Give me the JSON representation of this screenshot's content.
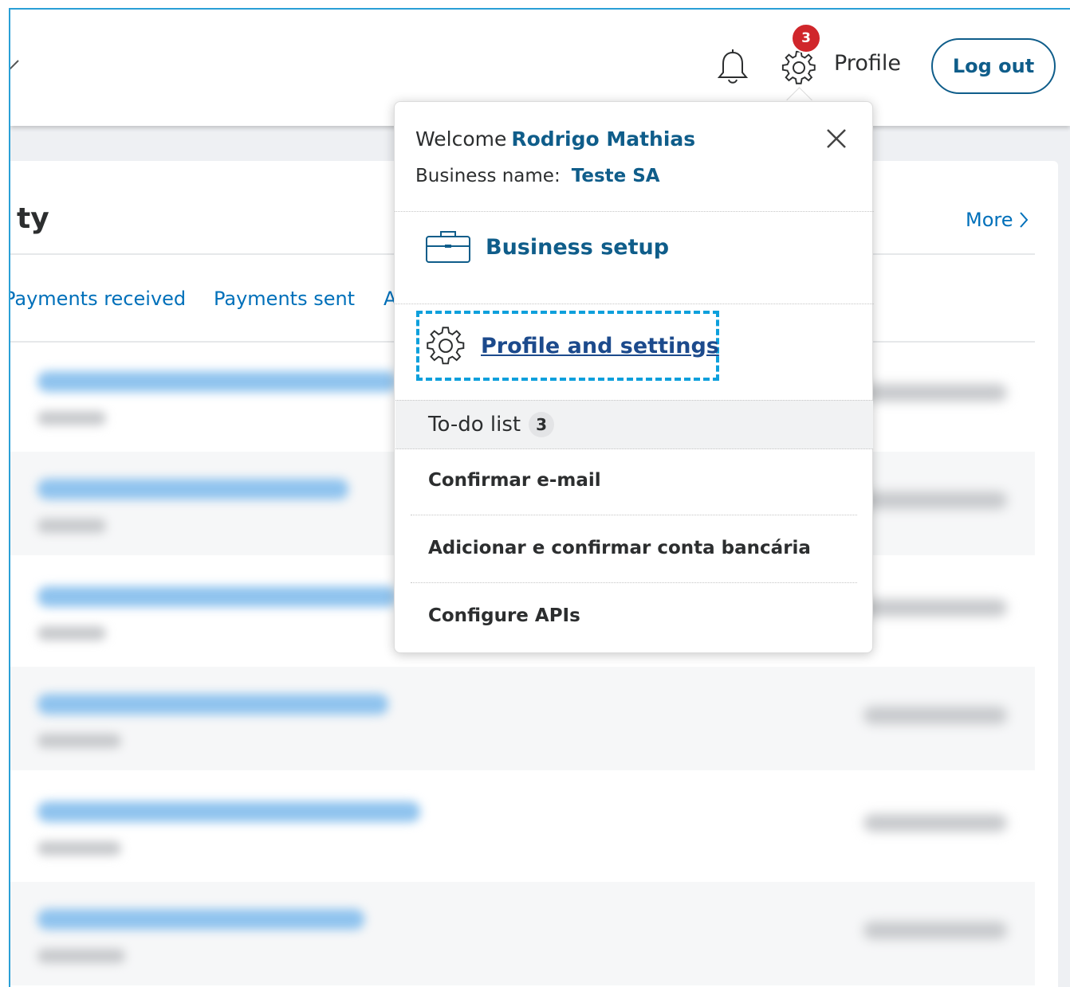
{
  "header": {
    "notification_badge": "3",
    "profile_label": "Profile",
    "logout_label": "Log out"
  },
  "activity": {
    "title_fragment": "ty",
    "more_label": "More",
    "tabs": [
      {
        "label": "Payments received"
      },
      {
        "label": "Payments sent"
      },
      {
        "label": "A"
      }
    ]
  },
  "dropdown": {
    "welcome_prefix": "Welcome",
    "user_name": "Rodrigo Mathias",
    "business_label": "Business name:",
    "business_name": "Teste SA",
    "business_setup_label": "Business setup",
    "profile_settings_label": "Profile and settings",
    "todo_title": "To-do list",
    "todo_count": "3",
    "todo_items": [
      {
        "label": "Confirmar e-mail"
      },
      {
        "label": "Adicionar e confirmar conta bancária"
      },
      {
        "label": "Configure APIs"
      }
    ]
  },
  "colors": {
    "brand_blue": "#0f5d8a",
    "link_blue": "#0070ba",
    "badge_red": "#d0262b",
    "focus_ring": "#0ea0dc"
  }
}
